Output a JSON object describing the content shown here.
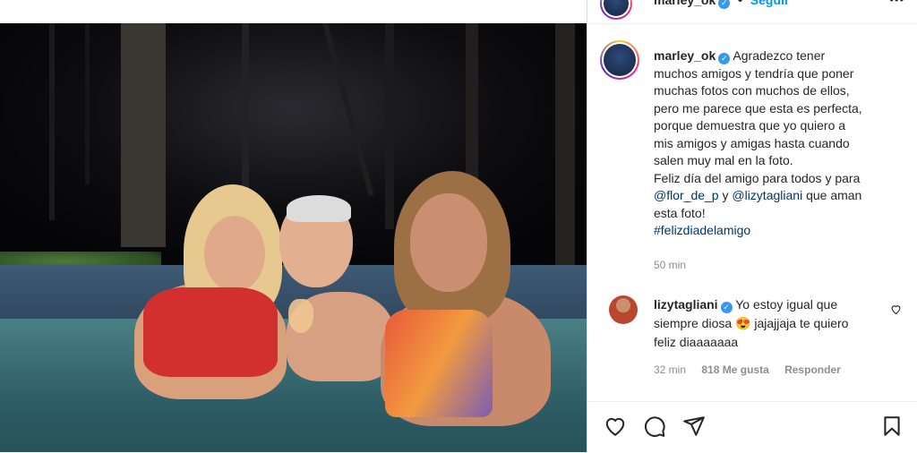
{
  "post": {
    "username": "marley_ok",
    "follow_label": "Seguir",
    "more_label": "•••",
    "caption_lines": [
      "Agradezco tener",
      "muchos amigos y tendría que poner",
      "muchas fotos con muchos de ellos,",
      "pero me parece que esta es perfecta,",
      "porque demuestra que yo quiero a",
      "mis amigos y amigas hasta cuando",
      "salen muy mal en la foto.",
      "Feliz día del amigo para todos y para"
    ],
    "mention1": "@flor_de_p",
    "mention_join": " y ",
    "mention2": "@lizytagliani",
    "mention_after": " que aman",
    "caption_end": "esta foto!",
    "hashtag": "#felizdiadelamigo",
    "time": "50 min"
  },
  "comment": {
    "username": "lizytagliani",
    "text_line1": "Yo estoy igual que",
    "text_line2a": "siempre diosa ",
    "emoji": "😍",
    "text_line2b": " jajajjaja te quiero",
    "text_line3": "feliz diaaaaaaa",
    "time": "32 min",
    "likes": "818 Me gusta",
    "reply_label": "Responder"
  },
  "icons": {
    "like": "heart-icon",
    "comment": "comment-icon",
    "share": "share-icon",
    "save": "bookmark-icon",
    "comment_like": "small-heart-icon"
  },
  "colors": {
    "link": "#00376b",
    "follow": "#0095f6",
    "verified": "#3897f0"
  }
}
